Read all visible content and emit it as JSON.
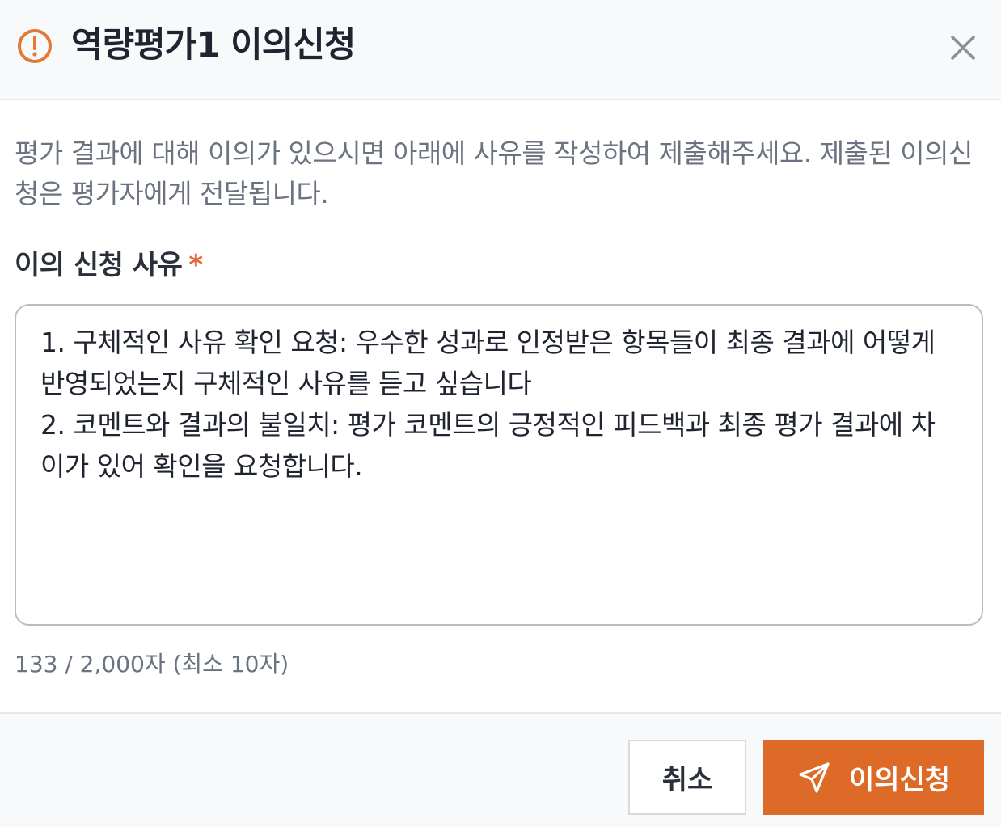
{
  "dialog": {
    "title": "역량평가1 이의신청",
    "icon": "alert-circle-icon",
    "close_icon": "close-icon",
    "accent_color": "#dd6a26"
  },
  "description": "평가 결과에 대해 이의가 있으시면 아래에 사유를 작성하여 제출해주세요. 제출된 이의신청은 평가자에게 전달됩니다.",
  "field": {
    "label": "이의 신청 사유",
    "required_mark": "*",
    "value": "1. 구체적인 사유 확인 요청: 우수한 성과로 인정받은 항목들이 최종 결과에 어떻게 반영되었는지 구체적인 사유를 듣고 싶습니다\n2. 코멘트와 결과의 불일치: 평가 코멘트의 긍정적인 피드백과 최종 평가 결과에 차이가 있어 확인을 요청합니다.",
    "counter": "133 / 2,000자 (최소 10자)"
  },
  "footer": {
    "cancel_label": "취소",
    "submit_label": "이의신청",
    "submit_icon": "send-icon"
  }
}
